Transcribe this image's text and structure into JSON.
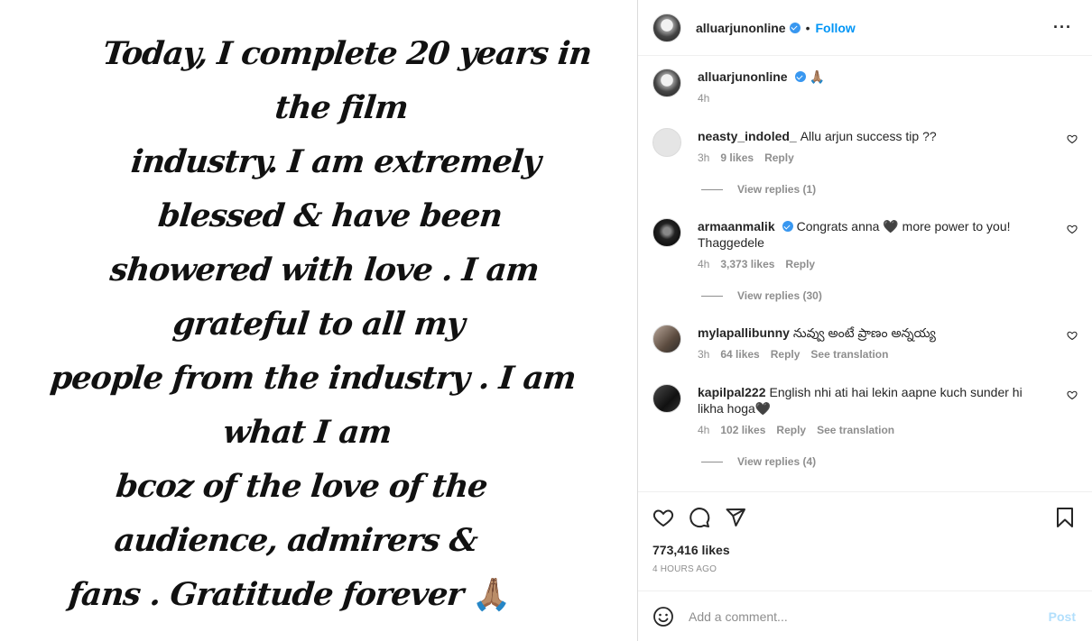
{
  "post": {
    "image_text_lines": [
      "Today, I complete 20 years in the film",
      "industry. I am extremely blessed & have been",
      "showered with love . I am grateful to all my",
      "people from the industry . I am what I am",
      "bcoz of the love of the audience, admirers &",
      "fans . Gratitude forever"
    ],
    "image_emoji": "🙏🏽"
  },
  "header": {
    "username": "alluarjunonline",
    "separator": "•",
    "follow_label": "Follow",
    "more_label": "···"
  },
  "caption": {
    "username": "alluarjunonline",
    "text": "🙏🏽",
    "time": "4h"
  },
  "comments": [
    {
      "username": "neasty_indoled_",
      "text": "Allu arjun success tip ??",
      "time": "3h",
      "likes": "9 likes",
      "reply": "Reply",
      "translation": "",
      "view_replies": "View replies (1)"
    },
    {
      "username": "armaanmalik",
      "text": "Congrats anna 🖤 more power to you! Thaggedele",
      "time": "4h",
      "likes": "3,373 likes",
      "reply": "Reply",
      "translation": "",
      "view_replies": "View replies (30)"
    },
    {
      "username": "mylapallibunny",
      "text": "నువ్వు అంటే ప్రాణం అన్నయ్య",
      "time": "3h",
      "likes": "64 likes",
      "reply": "Reply",
      "translation": "See translation",
      "view_replies": ""
    },
    {
      "username": "kapilpal222",
      "text": "English nhi ati hai lekin aapne kuch sunder hi likha hoga🖤",
      "time": "4h",
      "likes": "102 likes",
      "reply": "Reply",
      "translation": "See translation",
      "view_replies": "View replies (4)"
    }
  ],
  "engagement": {
    "likes": "773,416 likes",
    "time_ago": "4 HOURS AGO"
  },
  "add_comment": {
    "placeholder": "Add a comment...",
    "post_label": "Post"
  },
  "colors": {
    "accent": "#0095f6",
    "muted": "#8e8e8e",
    "post_disabled": "#b2dffc",
    "verified": "#3897f0"
  }
}
